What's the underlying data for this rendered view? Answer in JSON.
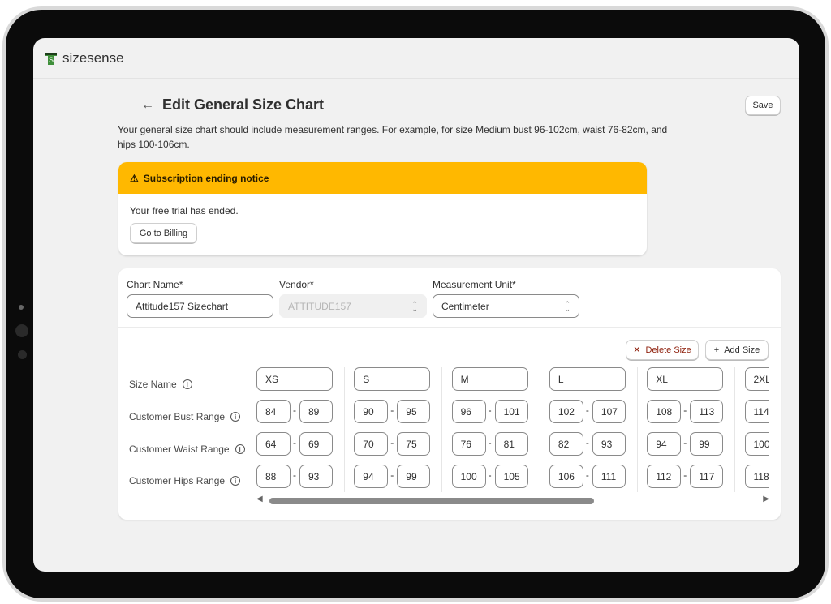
{
  "app": {
    "name": "sizesense"
  },
  "page": {
    "title": "Edit General Size Chart",
    "save_label": "Save",
    "description": "Your general size chart should include measurement ranges. For example, for size Medium bust 96-102cm, waist 76-82cm, and hips 100-106cm."
  },
  "banner": {
    "title": "Subscription ending notice",
    "message": "Your free trial has ended.",
    "button": "Go to Billing",
    "color": "#ffb800"
  },
  "form": {
    "chart_name": {
      "label": "Chart Name*",
      "value": "Attitude157 Sizechart"
    },
    "vendor": {
      "label": "Vendor*",
      "value": "ATTITUDE157"
    },
    "unit": {
      "label": "Measurement Unit*",
      "value": "Centimeter"
    }
  },
  "actions": {
    "delete": "Delete Size",
    "add": "Add Size"
  },
  "rows": [
    "Size Name",
    "Customer Bust Range",
    "Customer Waist Range",
    "Customer Hips Range"
  ],
  "sizes": [
    {
      "name": "XS",
      "bust": [
        "84",
        "89"
      ],
      "waist": [
        "64",
        "69"
      ],
      "hips": [
        "88",
        "93"
      ]
    },
    {
      "name": "S",
      "bust": [
        "90",
        "95"
      ],
      "waist": [
        "70",
        "75"
      ],
      "hips": [
        "94",
        "99"
      ]
    },
    {
      "name": "M",
      "bust": [
        "96",
        "101"
      ],
      "waist": [
        "76",
        "81"
      ],
      "hips": [
        "100",
        "105"
      ]
    },
    {
      "name": "L",
      "bust": [
        "102",
        "107"
      ],
      "waist": [
        "82",
        "93"
      ],
      "hips": [
        "106",
        "111"
      ]
    },
    {
      "name": "XL",
      "bust": [
        "108",
        "113"
      ],
      "waist": [
        "94",
        "99"
      ],
      "hips": [
        "112",
        "117"
      ]
    },
    {
      "name": "2XL",
      "bust": [
        "114",
        ""
      ],
      "waist": [
        "100",
        ""
      ],
      "hips": [
        "118",
        ""
      ]
    }
  ]
}
